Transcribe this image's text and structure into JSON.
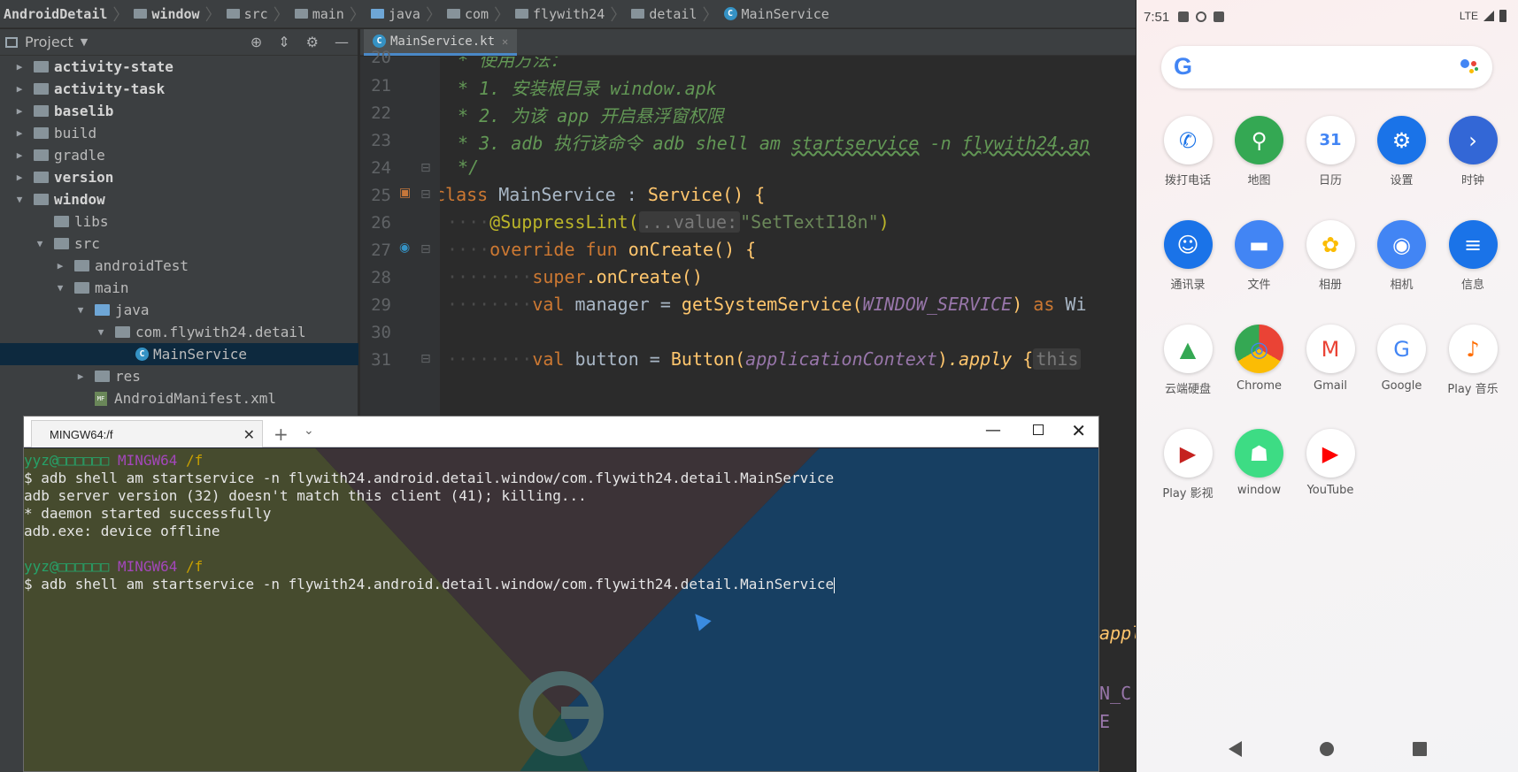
{
  "ide": {
    "breadcrumb": [
      "AndroidDetail",
      "window",
      "src",
      "main",
      "java",
      "com",
      "flywith24",
      "detail",
      "MainService"
    ],
    "project_panel_title": "Project",
    "tree": [
      {
        "label": "activity-state",
        "depth": 0,
        "expanded": false,
        "bold": true
      },
      {
        "label": "activity-task",
        "depth": 0,
        "expanded": false,
        "bold": true
      },
      {
        "label": "baselib",
        "depth": 0,
        "expanded": false,
        "bold": true
      },
      {
        "label": "build",
        "depth": 0,
        "expanded": false,
        "bold": false
      },
      {
        "label": "gradle",
        "depth": 0,
        "expanded": false,
        "bold": false
      },
      {
        "label": "version",
        "depth": 0,
        "expanded": false,
        "bold": true
      },
      {
        "label": "window",
        "depth": 0,
        "expanded": true,
        "bold": true
      },
      {
        "label": "libs",
        "depth": 1,
        "expanded": null,
        "bold": false
      },
      {
        "label": "src",
        "depth": 1,
        "expanded": true,
        "bold": false
      },
      {
        "label": "androidTest",
        "depth": 2,
        "expanded": false,
        "bold": false
      },
      {
        "label": "main",
        "depth": 2,
        "expanded": true,
        "bold": false
      },
      {
        "label": "java",
        "depth": 3,
        "expanded": true,
        "bold": false
      },
      {
        "label": "com.flywith24.detail",
        "depth": 4,
        "expanded": true,
        "bold": false
      },
      {
        "label": "MainService",
        "depth": 5,
        "expanded": null,
        "bold": false,
        "selected": true
      },
      {
        "label": "res",
        "depth": 3,
        "expanded": false,
        "bold": false
      },
      {
        "label": "AndroidManifest.xml",
        "depth": 3,
        "expanded": null,
        "bold": false
      }
    ],
    "editor_tab": "MainService.kt",
    "line_numbers": [
      "20",
      "21",
      "22",
      "23",
      "24",
      "25",
      "26",
      "27",
      "28",
      "29",
      "30",
      "31"
    ],
    "code": {
      "l20": " * 使用方法：",
      "l21": " * 1. 安装根目录 window.apk",
      "l22": " * 2. 为该 app 开启悬浮窗权限",
      "l23_a": " * 3. adb 执行该命令 adb shell am ",
      "l23_b": "startservice",
      "l23_c": " -n ",
      "l23_d": "flywith24.an",
      "l24": " */",
      "l25_kw": "class ",
      "l25_name": "MainService",
      "l25_colon": " : ",
      "l25_sup": "Service",
      "l25_end": "() {",
      "l26_ann": "@SuppressLint",
      "l26_hint": "...value:",
      "l26_str": "\"SetTextI18n\"",
      "l26_end": ")",
      "l27_kw": "override fun ",
      "l27_fn": "onCreate",
      "l27_end": "() {",
      "l28_kw": "super",
      "l28_fn": ".onCreate",
      "l28_end": "()",
      "l29_kw": "val ",
      "l29_var": "manager",
      "l29_eq": " = ",
      "l29_fn": "getSystemService",
      "l29_const": "WINDOW_SERVICE",
      "l29_as": " as ",
      "l29_tail": "Wi",
      "l31_kw": "val ",
      "l31_var": "button",
      "l31_eq": " = ",
      "l31_cls": "Button",
      "l31_param": "applicationContext",
      "l31_apply": ".apply",
      "l31_brace": " {",
      "l31_hint": "this",
      "right_frag_1": "appl",
      "right_frag_2": "N_C",
      "right_frag_3": "E"
    }
  },
  "terminal": {
    "tab_title": "MINGW64:/f",
    "lines": [
      {
        "user": "yyz@",
        "host": "□□□□□□",
        "mingw": "MINGW64",
        "path": "/f"
      },
      {
        "text": "$ adb shell am startservice -n flywith24.android.detail.window/com.flywith24.detail.MainService"
      },
      {
        "text": "adb server version (32) doesn't match this client (41); killing..."
      },
      {
        "text": "* daemon started successfully"
      },
      {
        "text": "adb.exe: device offline"
      },
      {
        "text": ""
      },
      {
        "user": "yyz@",
        "host": "□□□□□□",
        "mingw": "MINGW64",
        "path": "/f"
      },
      {
        "text": "$ adb shell am startservice -n flywith24.android.detail.window/com.flywith24.detail.MainService"
      }
    ]
  },
  "android": {
    "time": "7:51",
    "network": "LTE",
    "apps": [
      {
        "label": "拨打电话",
        "icon": "phone-icon",
        "color": "#1a73e8"
      },
      {
        "label": "地图",
        "icon": "maps-icon",
        "color": "#34a853"
      },
      {
        "label": "日历",
        "icon": "calendar-icon",
        "color": "#4285f4",
        "text": "31"
      },
      {
        "label": "设置",
        "icon": "settings-icon",
        "color": "#1a73e8"
      },
      {
        "label": "时钟",
        "icon": "clock-icon",
        "color": "#3367d6"
      },
      {
        "label": "通讯录",
        "icon": "contacts-icon",
        "color": "#1a73e8"
      },
      {
        "label": "文件",
        "icon": "files-icon",
        "color": "#4285f4"
      },
      {
        "label": "相册",
        "icon": "photos-icon",
        "color": "#fbbc04"
      },
      {
        "label": "相机",
        "icon": "camera-icon",
        "color": "#4285f4"
      },
      {
        "label": "信息",
        "icon": "messages-icon",
        "color": "#1a73e8"
      },
      {
        "label": "云端硬盘",
        "icon": "drive-icon",
        "color": "#34a853"
      },
      {
        "label": "Chrome",
        "icon": "chrome-icon",
        "color": "#ea4335"
      },
      {
        "label": "Gmail",
        "icon": "gmail-icon",
        "color": "#ea4335"
      },
      {
        "label": "Google",
        "icon": "google-icon",
        "color": "#4285f4"
      },
      {
        "label": "Play 音乐",
        "icon": "play-music-icon",
        "color": "#ff6d00"
      },
      {
        "label": "Play 影视",
        "icon": "play-movies-icon",
        "color": "#c5221f"
      },
      {
        "label": "window",
        "icon": "android-icon",
        "color": "#3ddc84"
      },
      {
        "label": "YouTube",
        "icon": "youtube-icon",
        "color": "#ff0000"
      }
    ]
  }
}
